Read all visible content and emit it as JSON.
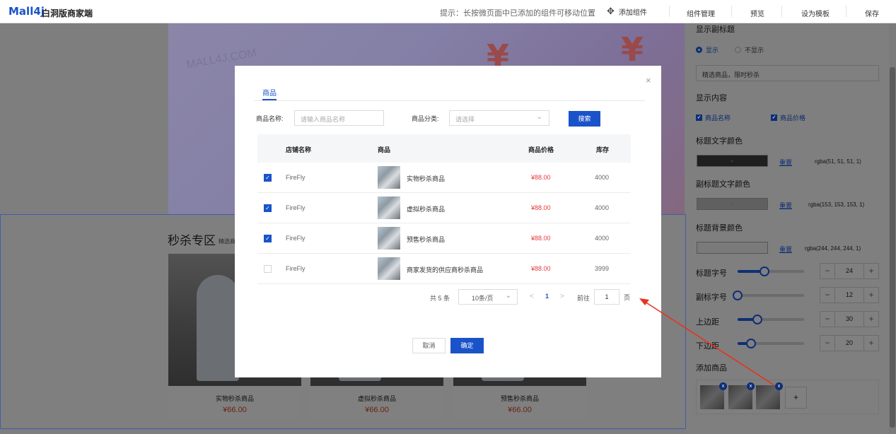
{
  "topbar": {
    "logo": "Mall4j",
    "brand": "白洞版商家端",
    "tip": "提示：长按微页面中已添加的组件可移动位置",
    "add_component": "添加组件",
    "add_component_icon": "move-cross-icon",
    "menu": [
      "组件管理",
      "预览",
      "设为模板",
      "保存"
    ]
  },
  "canvas": {
    "banner_watermark": "MALL4J.COM",
    "seckill_title": "秒杀专区",
    "seckill_subtitle": "精选商",
    "products": [
      {
        "name": "实物秒杀商品",
        "price": "¥66.00"
      },
      {
        "name": "虚拟秒杀商品",
        "price": "¥66.00"
      },
      {
        "name": "预售秒杀商品",
        "price": "¥66.00"
      }
    ]
  },
  "panel": {
    "show_subtitle_label": "显示副标题",
    "radio_show": "显示",
    "radio_hide": "不显示",
    "subtitle_value": "精选商品，限时秒杀",
    "display_content_label": "显示内容",
    "check_name": "商品名称",
    "check_price": "商品价格",
    "title_color_label": "标题文字颜色",
    "title_color_value": "rgba(51, 51, 51, 1)",
    "title_color_hex": "#1f1f1f",
    "subtitle_color_label": "副标题文字颜色",
    "subtitle_color_value": "rgba(153, 153, 153, 1)",
    "subtitle_color_hex": "#606060",
    "bg_color_label": "标题背景颜色",
    "bg_color_value": "rgba(244, 244, 244, 1)",
    "bg_color_hex": "#7a7a7a",
    "reset": "重置",
    "sliders": [
      {
        "label": "标题字号",
        "value": "24",
        "fraction": 0.4
      },
      {
        "label": "副标字号",
        "value": "12",
        "fraction": 0.0
      },
      {
        "label": "上边距",
        "value": "30",
        "fraction": 0.3
      },
      {
        "label": "下边距",
        "value": "20",
        "fraction": 0.2
      }
    ],
    "add_goods_label": "添加商品",
    "add_goods_count": 3,
    "remove_icon": "x",
    "add_button": "+"
  },
  "modal": {
    "close": "×",
    "tab": "商品",
    "name_label": "商品名称:",
    "name_placeholder": "请输入商品名称",
    "category_label": "商品分类:",
    "category_placeholder": "请选择",
    "search_button": "搜索",
    "columns": [
      "店铺名称",
      "商品",
      "商品价格",
      "库存"
    ],
    "rows": [
      {
        "checked": true,
        "shop": "FireFly",
        "product": "实物秒杀商品",
        "price": "¥88.00",
        "stock": "4000"
      },
      {
        "checked": true,
        "shop": "FireFly",
        "product": "虚拟秒杀商品",
        "price": "¥88.00",
        "stock": "4000"
      },
      {
        "checked": true,
        "shop": "FireFly",
        "product": "预售秒杀商品",
        "price": "¥88.00",
        "stock": "4000"
      },
      {
        "checked": false,
        "shop": "FireFly",
        "product": "商家发货的供应商秒杀商品",
        "price": "¥88.00",
        "stock": "3999"
      }
    ],
    "pager": {
      "total": "共 5 条",
      "page_size": "10条/页",
      "prev": "<",
      "current": "1",
      "next": ">",
      "goto": "前往",
      "goto_value": "1",
      "unit": "页"
    },
    "cancel": "取消",
    "ok": "确定"
  },
  "colors": {
    "primary": "#1a53c9",
    "price": "#e4393c",
    "arrow": "#e8321e"
  }
}
